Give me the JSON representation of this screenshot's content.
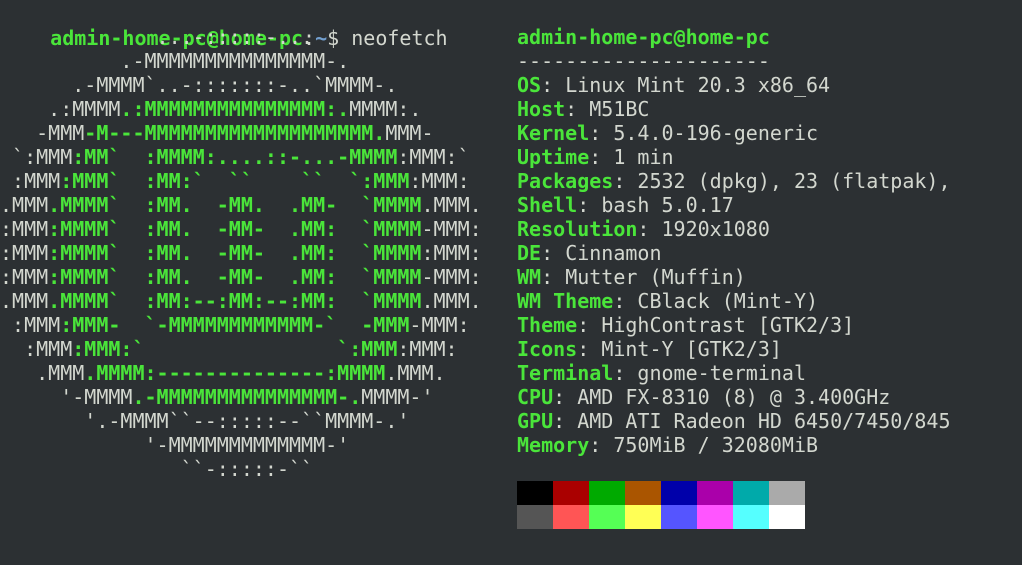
{
  "prompt": {
    "user_host": "admin-home-pc@home-pc",
    "sep": ":",
    "path": "~",
    "dollar": "$ ",
    "command": "neofetch"
  },
  "logo": [
    [
      [
        "w",
        "             ...-:::::-..."
      ]
    ],
    [
      [
        "w",
        "          .-MMMMMMMMMMMMMMM-."
      ]
    ],
    [
      [
        "w",
        "      .-MMMM`..-:::::::-..`MMMM-."
      ]
    ],
    [
      [
        "w",
        "    .:MMMM"
      ],
      [
        "g",
        ".:MMMMMMMMMMMMMMM:."
      ],
      [
        "w",
        "MMMM:."
      ]
    ],
    [
      [
        "w",
        "   -MMM"
      ],
      [
        "g",
        "-M---MMMMMMMMMMMMMMMMMMM."
      ],
      [
        "w",
        "MMM-"
      ]
    ],
    [
      [
        "w",
        " `:MMM"
      ],
      [
        "g",
        ":MM`  :MMMM:....::-...-MMMM"
      ],
      [
        "w",
        ":MMM:`"
      ]
    ],
    [
      [
        "w",
        " :MMM"
      ],
      [
        "g",
        ":MMM`  :MM:`  ``    ``  `:MMM"
      ],
      [
        "w",
        ":MMM:"
      ]
    ],
    [
      [
        "w",
        ".MMM"
      ],
      [
        "g",
        ".MMMM`  :MM.  -MM.  .MM-  `MMMM"
      ],
      [
        "w",
        ".MMM."
      ]
    ],
    [
      [
        "w",
        ":MMM"
      ],
      [
        "g",
        ":MMMM`  :MM.  -MM-  .MM:  `MMMM"
      ],
      [
        "w",
        "-MMM:"
      ]
    ],
    [
      [
        "w",
        ":MMM"
      ],
      [
        "g",
        ":MMMM`  :MM.  -MM-  .MM:  `MMMM"
      ],
      [
        "w",
        ":MMM:"
      ]
    ],
    [
      [
        "w",
        ":MMM"
      ],
      [
        "g",
        ":MMMM`  :MM.  -MM-  .MM:  `MMMM"
      ],
      [
        "w",
        "-MMM:"
      ]
    ],
    [
      [
        "w",
        ".MMM"
      ],
      [
        "g",
        ".MMMM`  :MM:--:MM:--:MM:  `MMMM"
      ],
      [
        "w",
        ".MMM."
      ]
    ],
    [
      [
        "w",
        " :MMM"
      ],
      [
        "g",
        ":MMM-  `-MMMMMMMMMMMM-`  -MMM"
      ],
      [
        "w",
        "-MMM:"
      ]
    ],
    [
      [
        "w",
        "  :MMM"
      ],
      [
        "g",
        ":MMM:`                `:MMM"
      ],
      [
        "w",
        ":MMM:"
      ]
    ],
    [
      [
        "w",
        "   .MMM"
      ],
      [
        "g",
        ".MMMM:--------------:MMMM"
      ],
      [
        "w",
        ".MMM."
      ]
    ],
    [
      [
        "w",
        "     '-MMMM"
      ],
      [
        "g",
        ".-MMMMMMMMMMMMMMM-."
      ],
      [
        "w",
        "MMMM-'"
      ]
    ],
    [
      [
        "w",
        "       '.-MMMM``--:::::--``MMMM-.'"
      ]
    ],
    [
      [
        "w",
        "            '-MMMMMMMMMMMMM-'"
      ]
    ],
    [
      [
        "w",
        "               ``-:::::-``"
      ]
    ]
  ],
  "info": {
    "title": "admin-home-pc@home-pc",
    "separator": "---------------------",
    "rows": [
      {
        "key": "OS",
        "value": "Linux Mint 20.3 x86_64"
      },
      {
        "key": "Host",
        "value": "M51BC"
      },
      {
        "key": "Kernel",
        "value": "5.4.0-196-generic"
      },
      {
        "key": "Uptime",
        "value": "1 min"
      },
      {
        "key": "Packages",
        "value": "2532 (dpkg), 23 (flatpak),"
      },
      {
        "key": "Shell",
        "value": "bash 5.0.17"
      },
      {
        "key": "Resolution",
        "value": "1920x1080"
      },
      {
        "key": "DE",
        "value": "Cinnamon"
      },
      {
        "key": "WM",
        "value": "Mutter (Muffin)"
      },
      {
        "key": "WM Theme",
        "value": "CBlack (Mint-Y)"
      },
      {
        "key": "Theme",
        "value": "HighContrast [GTK2/3]"
      },
      {
        "key": "Icons",
        "value": "Mint-Y [GTK2/3]"
      },
      {
        "key": "Terminal",
        "value": "gnome-terminal"
      },
      {
        "key": "CPU",
        "value": "AMD FX-8310 (8) @ 3.400GHz"
      },
      {
        "key": "GPU",
        "value": "AMD ATI Radeon HD 6450/7450/845"
      },
      {
        "key": "Memory",
        "value": "750MiB / 32080MiB"
      }
    ]
  },
  "palette": {
    "normal": [
      "#000000",
      "#aa0000",
      "#00aa00",
      "#aa5500",
      "#0000aa",
      "#aa00aa",
      "#00aaaa",
      "#aaaaaa"
    ],
    "bright": [
      "#555555",
      "#ff5555",
      "#55ff55",
      "#ffff55",
      "#5555ff",
      "#ff55ff",
      "#55ffff",
      "#ffffff"
    ]
  }
}
